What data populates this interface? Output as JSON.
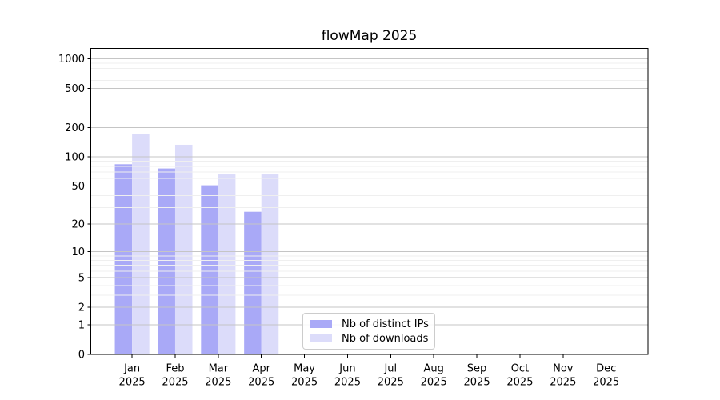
{
  "title": "flowMap 2025",
  "chart_data": {
    "type": "bar",
    "title": "flowMap 2025",
    "categories": [
      "Jan",
      "Feb",
      "Mar",
      "Apr",
      "May",
      "Jun",
      "Jul",
      "Aug",
      "Sep",
      "Oct",
      "Nov",
      "Dec"
    ],
    "category_year": "2025",
    "series": [
      {
        "name": "Nb of distinct IPs",
        "color": "#a9a9f7",
        "values": [
          84,
          76,
          51,
          27,
          0,
          0,
          0,
          0,
          0,
          0,
          0,
          0
        ]
      },
      {
        "name": "Nb of downloads",
        "color": "#dcdcfa",
        "values": [
          170,
          133,
          66,
          66,
          0,
          0,
          0,
          0,
          0,
          0,
          0,
          0
        ]
      }
    ],
    "y_scale": "log1p",
    "ylim": [
      0,
      1272
    ],
    "y_ticks": [
      0,
      1,
      2,
      5,
      10,
      20,
      50,
      100,
      200,
      500,
      1000
    ],
    "y_minor_gridlines": [
      3,
      4,
      6,
      7,
      8,
      9,
      30,
      40,
      60,
      70,
      80,
      90,
      300,
      400,
      600,
      700,
      800,
      900
    ],
    "grid": "horizontal, major and minor, drawn above bars",
    "legend_position": "bottom-center-left",
    "colors": {
      "major_grid": "#c5c5c5",
      "minor_grid": "#efefef",
      "axis": "#000000",
      "background": "#ffffff",
      "text": "#000000"
    }
  }
}
